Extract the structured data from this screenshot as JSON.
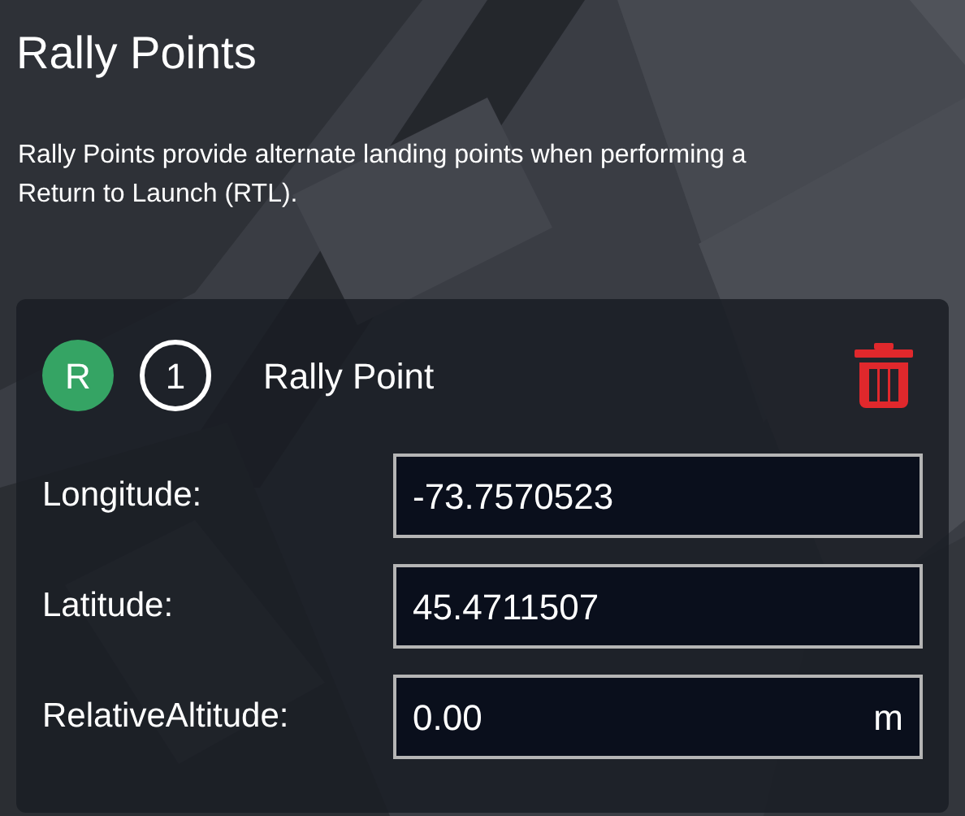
{
  "title": "Rally Points",
  "description": "Rally Points provide alternate landing points when performing a Return to Launch (RTL).",
  "rally_point": {
    "badge": "R",
    "index": "1",
    "name": "Rally Point",
    "fields": [
      {
        "label": "Longitude:",
        "value": "-73.7570523"
      },
      {
        "label": "Latitude:",
        "value": "45.4711507"
      },
      {
        "label": "RelativeAltitude:",
        "value": "0.00",
        "unit": "m"
      }
    ]
  }
}
